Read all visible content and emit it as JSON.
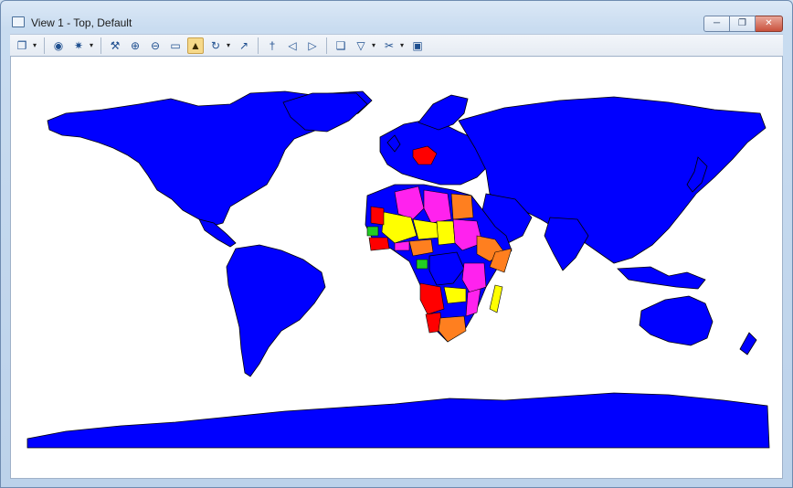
{
  "window": {
    "title": "View 1 - Top, Default",
    "controls": {
      "minimize_icon": "minimize-icon",
      "maximize_icon": "maximize-icon",
      "close_icon": "close-icon"
    }
  },
  "toolbar": {
    "buttons": [
      {
        "icon": "view-attributes-icon",
        "glyph": "❐",
        "has_dropdown": true
      },
      {
        "icon": "view-display-style-icon",
        "glyph": "◉",
        "has_dropdown": false
      },
      {
        "icon": "view-lighting-icon",
        "glyph": "✷",
        "has_dropdown": true
      },
      {
        "icon": "update-view-icon",
        "glyph": "⚒",
        "has_dropdown": false
      },
      {
        "icon": "zoom-in-icon",
        "glyph": "⊕",
        "has_dropdown": false
      },
      {
        "icon": "zoom-out-icon",
        "glyph": "⊖",
        "has_dropdown": false
      },
      {
        "icon": "window-area-icon",
        "glyph": "▭",
        "has_dropdown": false
      },
      {
        "icon": "fit-view-icon",
        "glyph": "▲",
        "has_dropdown": false,
        "active": true
      },
      {
        "icon": "rotate-view-icon",
        "glyph": "↻",
        "has_dropdown": true
      },
      {
        "icon": "pan-view-icon",
        "glyph": "↗",
        "has_dropdown": false
      },
      {
        "icon": "walk-icon",
        "glyph": "†",
        "has_dropdown": false
      },
      {
        "icon": "view-previous-icon",
        "glyph": "◁",
        "has_dropdown": false
      },
      {
        "icon": "view-next-icon",
        "glyph": "▷",
        "has_dropdown": false
      },
      {
        "icon": "copy-view-icon",
        "glyph": "❑",
        "has_dropdown": false
      },
      {
        "icon": "clip-volume-icon",
        "glyph": "▽",
        "has_dropdown": true
      },
      {
        "icon": "clip-mask-icon",
        "glyph": "✂",
        "has_dropdown": true
      },
      {
        "icon": "camera-icon",
        "glyph": "▣",
        "has_dropdown": false
      }
    ],
    "separator_after": [
      0,
      2,
      9,
      12
    ]
  },
  "map": {
    "description_name": "world-map",
    "colors": {
      "land": "#0000ff",
      "red": "#ff0000",
      "yellow": "#ffff00",
      "magenta": "#ff22ee",
      "orange": "#ff7f1f",
      "green": "#22cc22",
      "background": "#ffffff"
    }
  }
}
